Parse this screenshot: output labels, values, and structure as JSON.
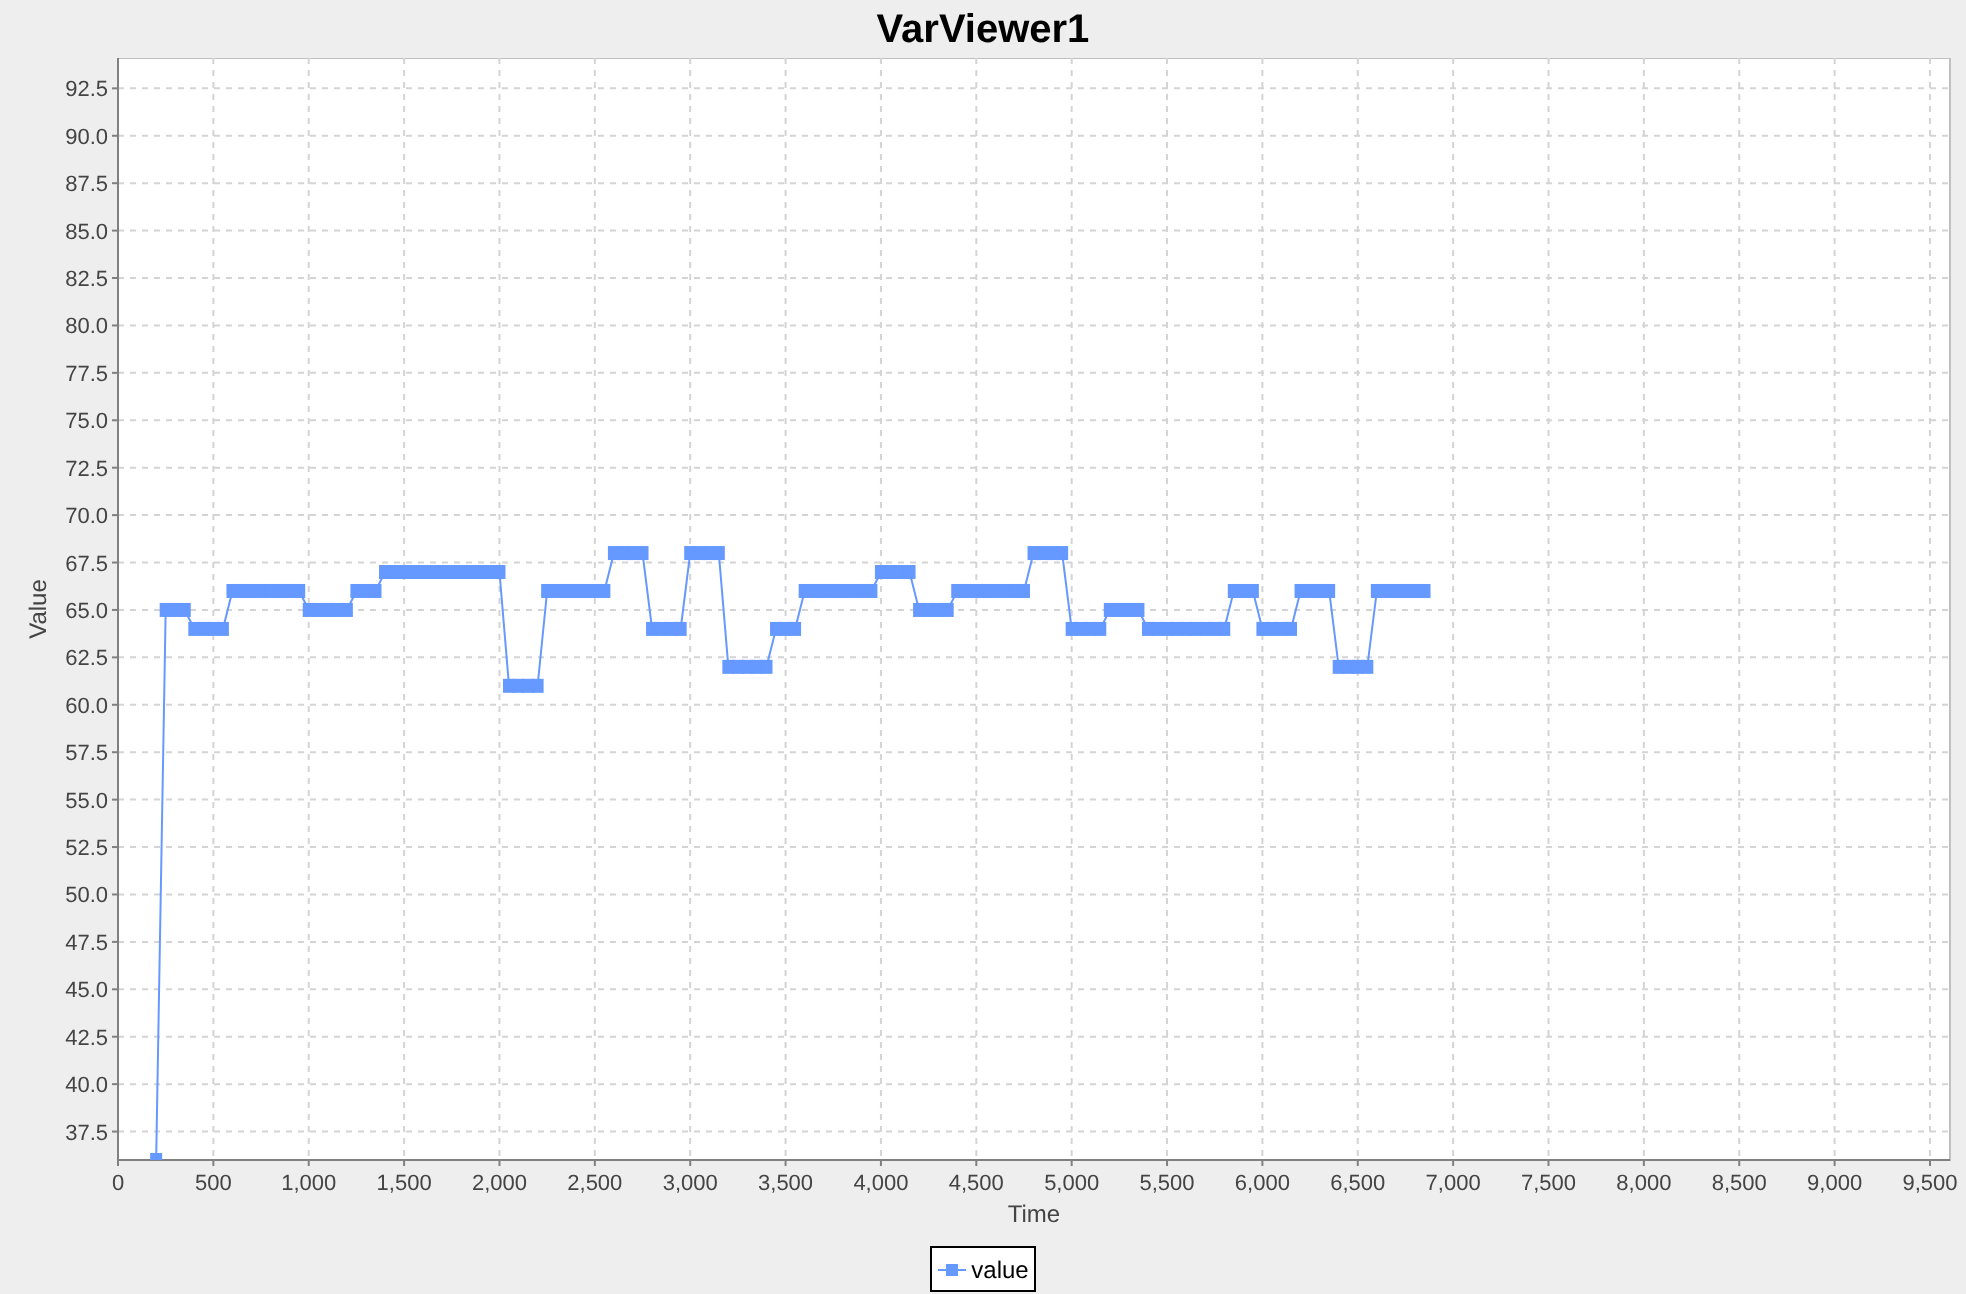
{
  "title": "VarViewer1",
  "chart_data": {
    "type": "line",
    "xlabel": "Time",
    "ylabel": "Value",
    "x": [
      200,
      250,
      300,
      350,
      400,
      450,
      500,
      550,
      600,
      650,
      700,
      750,
      800,
      850,
      900,
      950,
      1000,
      1050,
      1100,
      1150,
      1200,
      1250,
      1300,
      1350,
      1400,
      1450,
      1500,
      1550,
      1600,
      1650,
      1700,
      1750,
      1800,
      1850,
      1900,
      1950,
      2000,
      2050,
      2100,
      2150,
      2200,
      2250,
      2300,
      2350,
      2400,
      2450,
      2500,
      2550,
      2600,
      2650,
      2700,
      2750,
      2800,
      2850,
      2900,
      2950,
      3000,
      3050,
      3100,
      3150,
      3200,
      3250,
      3300,
      3350,
      3400,
      3450,
      3500,
      3550,
      3600,
      3650,
      3700,
      3750,
      3800,
      3850,
      3900,
      3950,
      4000,
      4050,
      4100,
      4150,
      4200,
      4250,
      4300,
      4350,
      4400,
      4450,
      4500,
      4550,
      4600,
      4650,
      4700,
      4750,
      4800,
      4850,
      4900,
      4950,
      5000,
      5050,
      5100,
      5150,
      5200,
      5250,
      5300,
      5350,
      5400,
      5450,
      5500,
      5550,
      5600,
      5650,
      5700,
      5750,
      5800,
      5850,
      5900,
      5950,
      6000,
      6050,
      6100,
      6150,
      6200,
      6250,
      6300,
      6350,
      6400,
      6450,
      6500,
      6550,
      6600,
      6650,
      6700,
      6750,
      6800,
      6850
    ],
    "series": [
      {
        "name": "value",
        "color": "#6699ff",
        "marker": "square",
        "values": [
          36.0,
          65,
          65,
          65,
          64,
          64,
          64,
          64,
          66,
          66,
          66,
          66,
          66,
          66,
          66,
          66,
          65,
          65,
          65,
          65,
          65,
          66,
          66,
          66,
          67,
          67,
          67,
          67,
          67,
          67,
          67,
          67,
          67,
          67,
          67,
          67,
          67,
          61,
          61,
          61,
          61,
          66,
          66,
          66,
          66,
          66,
          66,
          66,
          68,
          68,
          68,
          68,
          64,
          64,
          64,
          64,
          68,
          68,
          68,
          68,
          62,
          62,
          62,
          62,
          62,
          64,
          64,
          64,
          66,
          66,
          66,
          66,
          66,
          66,
          66,
          66,
          67,
          67,
          67,
          67,
          65,
          65,
          65,
          65,
          66,
          66,
          66,
          66,
          66,
          66,
          66,
          66,
          68,
          68,
          68,
          68,
          64,
          64,
          64,
          64,
          65,
          65,
          65,
          65,
          64,
          64,
          64,
          64,
          64,
          64,
          64,
          64,
          64,
          66,
          66,
          66,
          64,
          64,
          64,
          64,
          66,
          66,
          66,
          66,
          62,
          62,
          62,
          62,
          66,
          66,
          66,
          66,
          66,
          66
        ]
      }
    ],
    "grid": true,
    "xlim": [
      0,
      9605
    ],
    "ylim": [
      36.0,
      94.1
    ],
    "xticks": [
      0,
      500,
      {
        "value": 1000,
        "label": "1,000"
      },
      {
        "value": 1500,
        "label": "1,500"
      },
      {
        "value": 2000,
        "label": "2,000"
      },
      {
        "value": 2500,
        "label": "2,500"
      },
      {
        "value": 3000,
        "label": "3,000"
      },
      {
        "value": 3500,
        "label": "3,500"
      },
      {
        "value": 4000,
        "label": "4,000"
      },
      {
        "value": 4500,
        "label": "4,500"
      },
      {
        "value": 5000,
        "label": "5,000"
      },
      {
        "value": 5500,
        "label": "5,500"
      },
      {
        "value": 6000,
        "label": "6,000"
      },
      {
        "value": 6500,
        "label": "6,500"
      },
      {
        "value": 7000,
        "label": "7,000"
      },
      {
        "value": 7500,
        "label": "7,500"
      },
      {
        "value": 8000,
        "label": "8,000"
      },
      {
        "value": 8500,
        "label": "8,500"
      },
      {
        "value": 9000,
        "label": "9,000"
      },
      {
        "value": 9500,
        "label": "9,500"
      }
    ],
    "yticks": [
      37.5,
      {
        "value": 40,
        "label": "40.0"
      },
      42.5,
      {
        "value": 45,
        "label": "45.0"
      },
      47.5,
      {
        "value": 50,
        "label": "50.0"
      },
      52.5,
      {
        "value": 55,
        "label": "55.0"
      },
      57.5,
      {
        "value": 60,
        "label": "60.0"
      },
      62.5,
      {
        "value": 65,
        "label": "65.0"
      },
      67.5,
      {
        "value": 70,
        "label": "70.0"
      },
      72.5,
      {
        "value": 75,
        "label": "75.0"
      },
      77.5,
      {
        "value": 80,
        "label": "80.0"
      },
      82.5,
      {
        "value": 85,
        "label": "85.0"
      },
      87.5,
      {
        "value": 90,
        "label": "90.0"
      },
      92.5
    ]
  }
}
